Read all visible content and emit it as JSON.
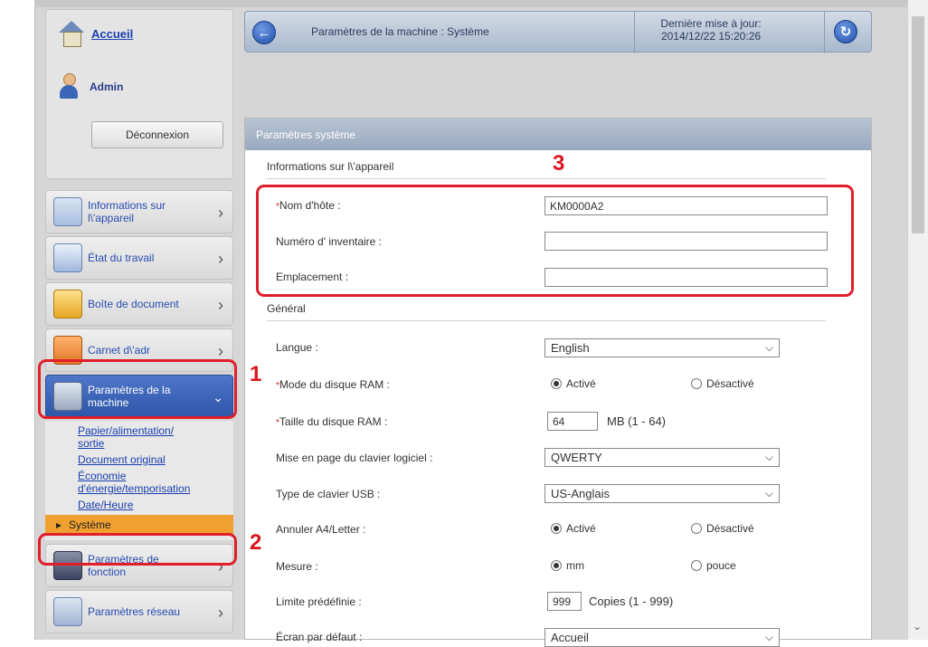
{
  "sidebar": {
    "home_label": "Accueil",
    "user_label": "Admin",
    "logout_label": "Déconnexion",
    "menu": [
      {
        "label": "Informations sur l\\'appareil",
        "icon": "device-info-icon"
      },
      {
        "label": "État du travail",
        "icon": "job-status-icon"
      },
      {
        "label": "Boîte de document",
        "icon": "document-box-icon"
      },
      {
        "label": "Carnet d\\'adr",
        "icon": "address-book-icon"
      },
      {
        "label": "Paramètres de la machine",
        "icon": "machine-settings-icon"
      },
      {
        "label": "Paramètres de fonction",
        "icon": "function-settings-icon"
      },
      {
        "label": "Paramètres réseau",
        "icon": "network-settings-icon"
      }
    ],
    "submenu": [
      "Papier/alimentation/ sortie",
      "Document original",
      "Économie d'énergie/temporisation",
      "Date/Heure"
    ],
    "current": "Système"
  },
  "header": {
    "title": "Paramètres de la machine : Système",
    "last_update_label": "Dernière mise à jour:",
    "last_update_value": "2014/12/22 15:20:26"
  },
  "main": {
    "panel_title": "Paramètres système",
    "device_section": "Informations sur l\\'appareil",
    "general_section": "Général",
    "fields": {
      "hostname_label": "Nom d'hôte :",
      "hostname_value": "KM0000A2",
      "asset_label": "Numéro d' inventaire :",
      "asset_value": "",
      "location_label": "Emplacement :",
      "location_value": "",
      "language_label": "Langue :",
      "language_value": "English",
      "ramdisk_mode_label": "Mode du disque RAM :",
      "ramdisk_size_label": "Taille du disque RAM :",
      "ramdisk_size_value": "64",
      "ramdisk_size_unit": "MB (1 - 64)",
      "keyboard_layout_label": "Mise en page du clavier logiciel :",
      "keyboard_layout_value": "QWERTY",
      "usb_keyboard_label": "Type de clavier USB :",
      "usb_keyboard_value": "US-Anglais",
      "a4_letter_label": "Annuler A4/Letter :",
      "measure_label": "Mesure :",
      "limit_label": "Limite prédéfinie :",
      "limit_value": "999",
      "limit_unit": "Copies (1 - 999)",
      "screen_label": "Écran par défaut :",
      "screen_value": "Accueil"
    },
    "options": {
      "enabled": "Activé",
      "disabled_ram": "Désactivé",
      "disabled_a4": "Désactivé",
      "mm": "mm",
      "inch": "pouce"
    }
  },
  "annotations": {
    "n1": "1",
    "n2": "2",
    "n3": "3"
  },
  "colors": {
    "annotation_red": "#e01f2a",
    "active_menu_blue": "#3b63b8",
    "current_item_orange": "#f0a030"
  }
}
